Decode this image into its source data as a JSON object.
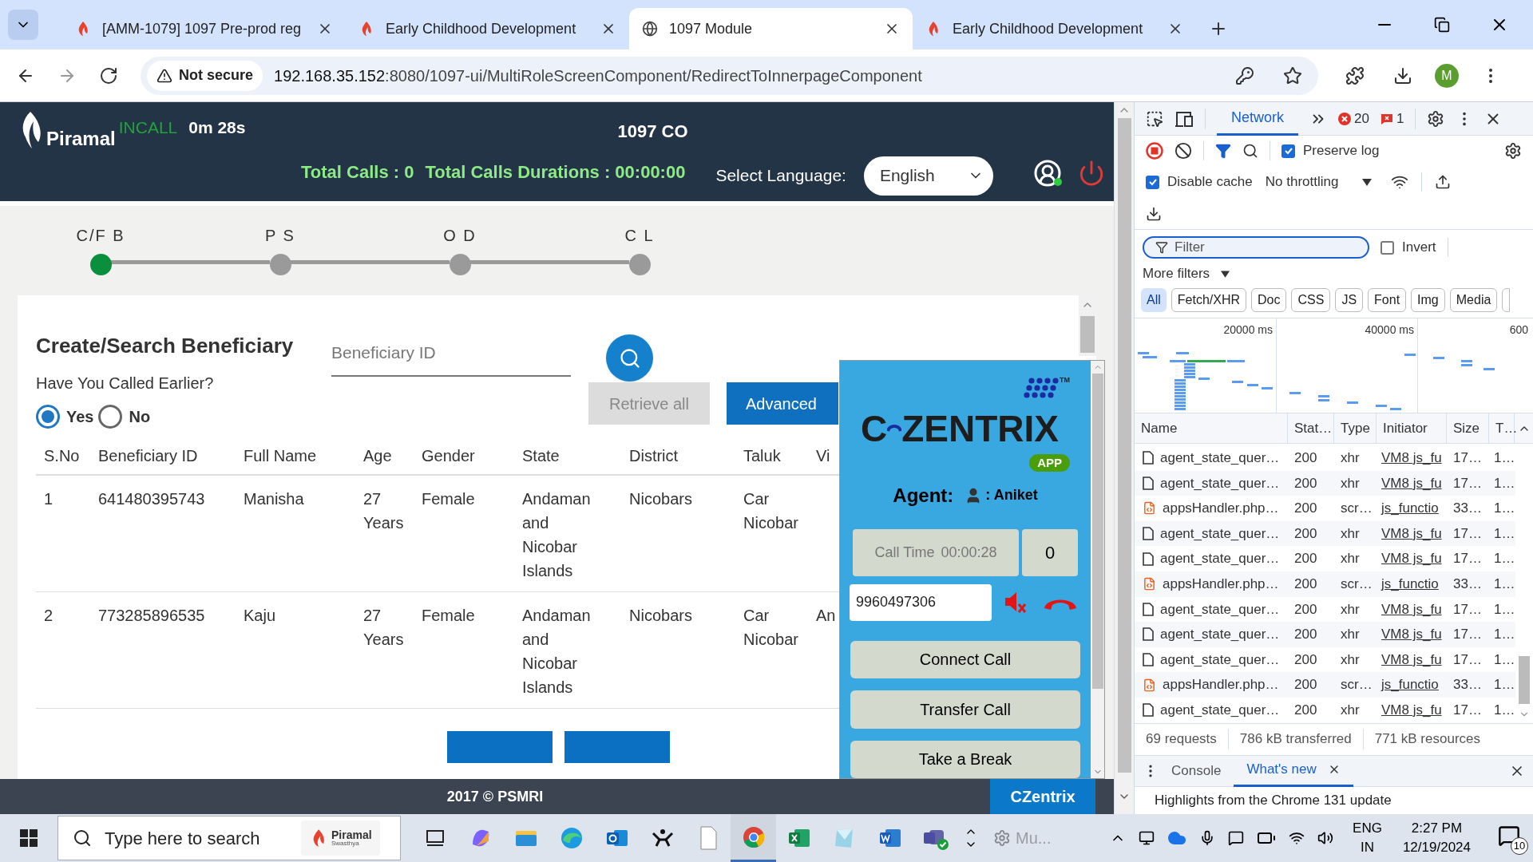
{
  "browser": {
    "tabs": [
      {
        "title": "[AMM-1079] 1097 Pre-prod reg",
        "kind": "flame",
        "selected": false
      },
      {
        "title": "Early Childhood Development",
        "kind": "flame",
        "selected": false
      },
      {
        "title": "1097 Module",
        "kind": "globe",
        "selected": true
      },
      {
        "title": "Early Childhood Development",
        "kind": "flame",
        "selected": false
      }
    ],
    "security": "Not secure",
    "url_host": "192.168.35.152",
    "url_path": ":8080/1097-ui/MultiRoleScreenComponent/RedirectToInnerpageComponent",
    "profile": "M"
  },
  "app": {
    "brand": "Piramal",
    "call_status": "INCALL",
    "call_timer": "0m 28s",
    "title": "1097 CO",
    "total_calls": "Total Calls : 0",
    "total_durations": "Total Calls Durations : 00:00:00",
    "language_label": "Select Language:",
    "language": "English"
  },
  "stepper": [
    {
      "label": "C/F B",
      "active": true
    },
    {
      "label": "P S",
      "active": false
    },
    {
      "label": "O D",
      "active": false
    },
    {
      "label": "C L",
      "active": false
    }
  ],
  "search_panel": {
    "title": "Create/Search Beneficiary",
    "id_placeholder": "Beneficiary ID",
    "question": "Have You Called Earlier?",
    "options": [
      {
        "label": "Yes",
        "selected": true
      },
      {
        "label": "No",
        "selected": false
      }
    ],
    "buttons": [
      {
        "label": "Retrieve all",
        "disabled": true
      },
      {
        "label": "Advanced",
        "disabled": false
      }
    ]
  },
  "table": {
    "columns": [
      "S.No",
      "Beneficiary ID",
      "Full Name",
      "Age",
      "Gender",
      "State",
      "District",
      "Taluk",
      "Vi"
    ],
    "rows": [
      [
        "1",
        "641480395743",
        "Manisha",
        "27 Years",
        "Female",
        "Andaman and Nicobar Islands",
        "Nicobars",
        "Car Nicobar"
      ],
      [
        "2",
        "773285896535",
        "Kaju",
        "27 Years",
        "Female",
        "Andaman and Nicobar Islands",
        "Nicobars",
        "Car Nicobar",
        "An"
      ]
    ]
  },
  "footer": {
    "copyright": "2017 © PSMRI",
    "dialer_button": "CZentrix"
  },
  "dialer": {
    "logo_left": "C",
    "logo_right": "ZENTRIX",
    "trademark": "TM",
    "badge": "APP",
    "agent_label": "Agent:",
    "agent_name": ": Aniket",
    "call_time_label": "Call Time",
    "call_time": "00:00:28",
    "counter": "0",
    "phone": "9960497306",
    "buttons": [
      "Connect Call",
      "Transfer Call",
      "Take a Break"
    ]
  },
  "devtools": {
    "tabs": [
      {
        "label": "Network",
        "selected": true
      }
    ],
    "errors": "20",
    "warnings": "1",
    "preserve_log": {
      "label": "Preserve log",
      "checked": true
    },
    "disable_cache": {
      "label": "Disable cache",
      "checked": true
    },
    "throttling": "No throttling",
    "filter_placeholder": "Filter",
    "invert": {
      "label": "Invert",
      "checked": false
    },
    "more_filters": "More filters",
    "type_filters": [
      {
        "label": "All",
        "selected": true
      },
      {
        "label": "Fetch/XHR",
        "selected": false
      },
      {
        "label": "Doc",
        "selected": false
      },
      {
        "label": "CSS",
        "selected": false
      },
      {
        "label": "JS",
        "selected": false
      },
      {
        "label": "Font",
        "selected": false
      },
      {
        "label": "Img",
        "selected": false
      },
      {
        "label": "Media",
        "selected": false
      }
    ],
    "overview_labels": [
      "20000 ms",
      "40000 ms",
      "600"
    ],
    "columns": [
      "Name",
      "Stat…",
      "Type",
      "Initiator",
      "Size",
      "T…"
    ],
    "requests": [
      {
        "kind": "xhr",
        "name": "agent_state_quer…",
        "status": "200",
        "type": "xhr",
        "initiator": "VM8 js_fu",
        "size": "17…",
        "time": "1…"
      },
      {
        "kind": "xhr",
        "name": "agent_state_quer…",
        "status": "200",
        "type": "xhr",
        "initiator": "VM8 js_fu",
        "size": "17…",
        "time": "1…"
      },
      {
        "kind": "script",
        "name": "appsHandler.php…",
        "status": "200",
        "type": "scr…",
        "initiator": "js_functio",
        "size": "33…",
        "time": "1…"
      },
      {
        "kind": "xhr",
        "name": "agent_state_quer…",
        "status": "200",
        "type": "xhr",
        "initiator": "VM8 js_fu",
        "size": "17…",
        "time": "1…"
      },
      {
        "kind": "xhr",
        "name": "agent_state_quer…",
        "status": "200",
        "type": "xhr",
        "initiator": "VM8 js_fu",
        "size": "17…",
        "time": "1…"
      },
      {
        "kind": "script",
        "name": "appsHandler.php…",
        "status": "200",
        "type": "scr…",
        "initiator": "js_functio",
        "size": "33…",
        "time": "1…"
      },
      {
        "kind": "xhr",
        "name": "agent_state_quer…",
        "status": "200",
        "type": "xhr",
        "initiator": "VM8 js_fu",
        "size": "17…",
        "time": "1…"
      },
      {
        "kind": "xhr",
        "name": "agent_state_quer…",
        "status": "200",
        "type": "xhr",
        "initiator": "VM8 js_fu",
        "size": "17…",
        "time": "1…"
      },
      {
        "kind": "xhr",
        "name": "agent_state_quer…",
        "status": "200",
        "type": "xhr",
        "initiator": "VM8 js_fu",
        "size": "17…",
        "time": "1…"
      },
      {
        "kind": "script",
        "name": "appsHandler.php…",
        "status": "200",
        "type": "scr…",
        "initiator": "js_functio",
        "size": "33…",
        "time": "1…"
      },
      {
        "kind": "xhr",
        "name": "agent_state_quer…",
        "status": "200",
        "type": "xhr",
        "initiator": "VM8 js_fu",
        "size": "17…",
        "time": "1…"
      }
    ],
    "summary": [
      "69 requests",
      "786 kB transferred",
      "771 kB resources"
    ],
    "drawer_tabs": [
      {
        "label": "Console",
        "selected": false
      },
      {
        "label": "What's new",
        "selected": true
      }
    ],
    "drawer_text": "Highlights from the Chrome 131 update"
  },
  "taskbar": {
    "search_placeholder": "Type here to search",
    "pinned_brand": "Piramal",
    "pinned_brand_sub": "Swasthya",
    "apps": [
      {
        "kind": "taskview",
        "active": false
      },
      {
        "kind": "copilot",
        "active": false
      },
      {
        "kind": "folder",
        "active": false
      },
      {
        "kind": "edge",
        "active": false
      },
      {
        "kind": "outlook",
        "active": false
      },
      {
        "kind": "figures",
        "active": false
      },
      {
        "kind": "file",
        "active": false
      },
      {
        "kind": "chrome",
        "active": true
      },
      {
        "kind": "excel",
        "active": false
      },
      {
        "kind": "glass",
        "active": false
      },
      {
        "kind": "word",
        "active": false
      },
      {
        "kind": "teams",
        "active": false
      }
    ],
    "preview": "Mu...",
    "language": "ENG",
    "region": "IN",
    "time": "2:27 PM",
    "date": "12/19/2024",
    "notifications": "10"
  }
}
